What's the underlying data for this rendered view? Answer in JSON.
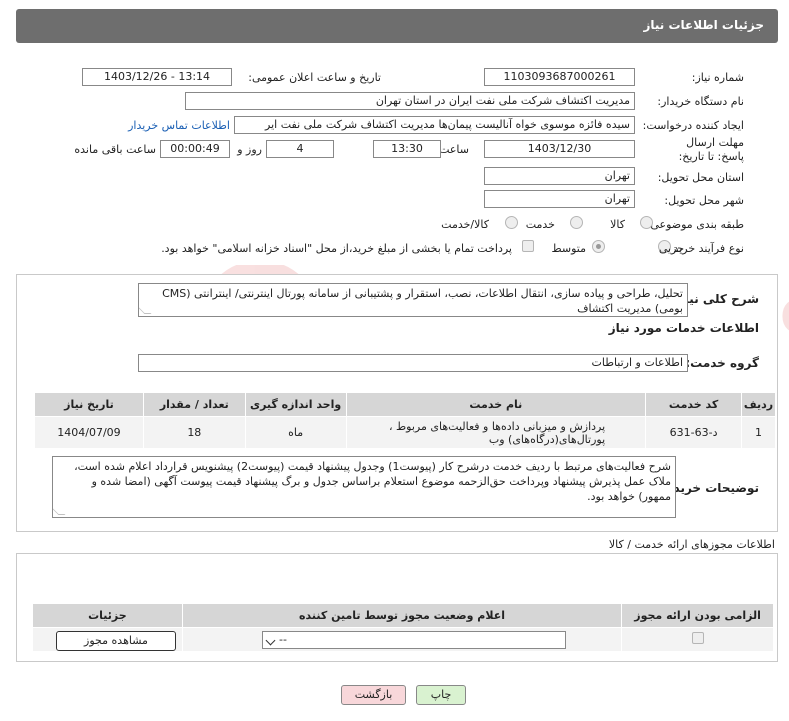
{
  "header": {
    "title": "جزئیات اطلاعات نیاز"
  },
  "fields": {
    "need_number_label": "شماره نیاز:",
    "need_number": "1103093687000261",
    "announce_label": "تاریخ و ساعت اعلان عمومی:",
    "announce_value": "1403/12/26 - 13:14",
    "buyer_org_label": "نام دستگاه خریدار:",
    "buyer_org": "مدیریت اکتشاف شرکت ملی نفت ایران در استان تهران",
    "creator_label": "ایجاد کننده درخواست:",
    "creator": "سیده فائزه موسوی خواه آنالیست پیمان‌ها مدیریت اکتشاف شرکت ملی نفت ایر",
    "contact_link": "اطلاعات تماس خریدار",
    "deadline_label": "مهلت ارسال پاسخ: تا تاریخ:",
    "deadline_date": "1403/12/30",
    "time_label": "ساعت",
    "deadline_time": "13:30",
    "days_value": "4",
    "days_label": "روز و",
    "remaining_time": "00:00:49",
    "remaining_label": "ساعت باقی مانده",
    "province_label": "استان محل تحویل:",
    "province": "تهران",
    "city_label": "شهر محل تحویل:",
    "city": "تهران",
    "category_label": "طبقه بندی موضوعی:",
    "category_options": [
      "کالا",
      "خدمت",
      "کالا/خدمت"
    ],
    "process_label": "نوع فرآیند خرید :",
    "process_options": [
      "جزیی",
      "متوسط"
    ],
    "payment_note": "پرداخت تمام یا بخشی از مبلغ خرید،از محل \"اسناد خزانه اسلامی\" خواهد بود."
  },
  "summary": {
    "label": "شرح کلی نیاز:",
    "text": "تحلیل، طراحی و پیاده سازی، انتقال اطلاعات، نصب، استقرار و پشتیبانی از سامانه پورتال اینترنتی/ اینترانتی (CMS بومی) مدیریت اکتشاف"
  },
  "services": {
    "section_title": "اطلاعات خدمات مورد نیاز",
    "group_label": "گروه خدمت:",
    "group_value": "اطلاعات و ارتباطات",
    "columns": [
      "ردیف",
      "کد خدمت",
      "نام خدمت",
      "واحد اندازه گیری",
      "تعداد / مقدار",
      "تاریخ نیاز"
    ],
    "rows": [
      {
        "row": "1",
        "code": "د-63-631",
        "name": "پردازش و میزبانی داده‌ها و فعالیت‌های مربوط ، پورتال‌های(درگاه‌های) وب",
        "unit": "ماه",
        "qty": "18",
        "date": "1404/07/09"
      }
    ]
  },
  "buyer_notes": {
    "label": "توضیحات خریدار:",
    "text": "شرح فعالیت‌های مرتبط با ردیف خدمت درشرح کار (پیوست1) وجدول پیشنهاد قیمت (پیوست2) پیشنویس قرارداد اعلام شده است، ملاک عمل پذیرش پیشنهاد وپرداخت حق‌الزحمه موضوع استعلام براساس جدول و برگ پیشنهاد قیمت پیوست آگهی (امضا شده و ممهور) خواهد بود."
  },
  "permits": {
    "section_title": "اطلاعات مجوزهای ارائه خدمت / کالا",
    "columns": [
      "الزامی بودن ارائه مجوز",
      "اعلام وضعیت مجوز توسط تامین کننده",
      "جزئیات"
    ],
    "select_value": "--",
    "view_button": "مشاهده مجوز"
  },
  "footer": {
    "print_button": "چاپ",
    "back_button": "بازگشت"
  },
  "watermark": "AriaTender.neT",
  "colors": {
    "header_bg": "#6e6e6e",
    "link": "#1a5fb4",
    "back_btn": "#f8d7da",
    "print_btn": "#d9f2d0"
  }
}
